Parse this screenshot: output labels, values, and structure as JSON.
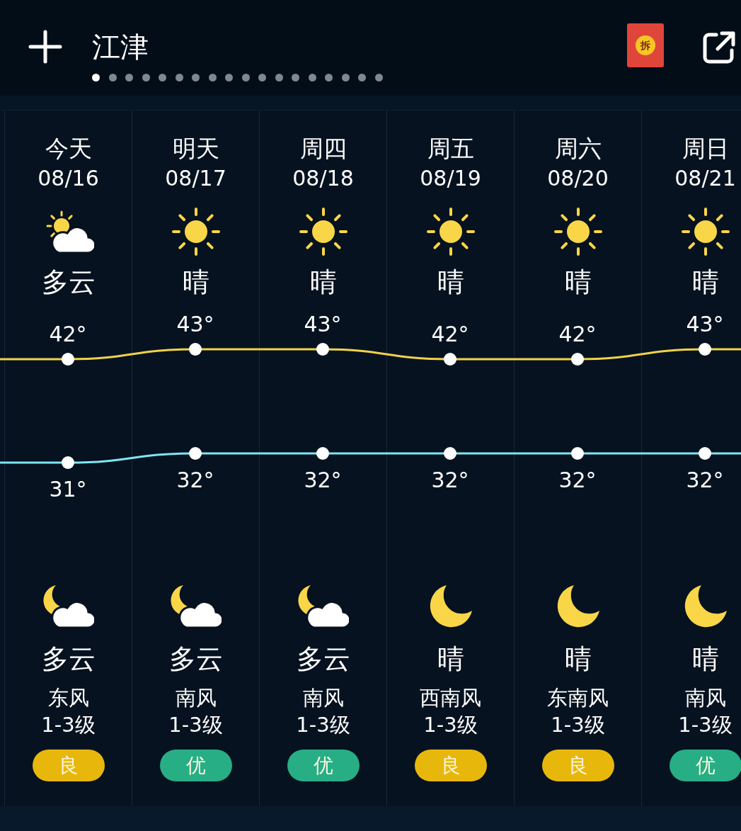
{
  "header": {
    "city": "江津",
    "red_packet": "拆"
  },
  "pages": [
    {
      "selected": true
    },
    {
      "selected": false
    },
    {
      "selected": false
    },
    {
      "selected": false
    },
    {
      "selected": false
    },
    {
      "selected": false
    },
    {
      "selected": false
    },
    {
      "selected": false
    },
    {
      "selected": false
    },
    {
      "selected": false
    },
    {
      "selected": false
    },
    {
      "selected": false
    },
    {
      "selected": false
    },
    {
      "selected": false
    },
    {
      "selected": false
    },
    {
      "selected": false
    },
    {
      "selected": false
    },
    {
      "selected": false
    }
  ],
  "days": [
    {
      "name": "今天",
      "date": "08/16",
      "day": {
        "kind": "partly_cloudy",
        "text": "多云"
      },
      "high": "42°",
      "low": "31°",
      "night": {
        "kind": "cloudy_night",
        "text": "多云"
      },
      "wind": "东风",
      "wind_level": "1-3级",
      "aqi": {
        "text": "良",
        "color": "#e8b70c"
      }
    },
    {
      "name": "明天",
      "date": "08/17",
      "day": {
        "kind": "sunny",
        "text": "晴"
      },
      "high": "43°",
      "low": "32°",
      "night": {
        "kind": "cloudy_night",
        "text": "多云"
      },
      "wind": "南风",
      "wind_level": "1-3级",
      "aqi": {
        "text": "优",
        "color": "#27ae85"
      }
    },
    {
      "name": "周四",
      "date": "08/18",
      "day": {
        "kind": "sunny",
        "text": "晴"
      },
      "high": "43°",
      "low": "32°",
      "night": {
        "kind": "cloudy_night",
        "text": "多云"
      },
      "wind": "南风",
      "wind_level": "1-3级",
      "aqi": {
        "text": "优",
        "color": "#27ae85"
      }
    },
    {
      "name": "周五",
      "date": "08/19",
      "day": {
        "kind": "sunny",
        "text": "晴"
      },
      "high": "42°",
      "low": "32°",
      "night": {
        "kind": "clear_night",
        "text": "晴"
      },
      "wind": "西南风",
      "wind_level": "1-3级",
      "aqi": {
        "text": "良",
        "color": "#e8b70c"
      }
    },
    {
      "name": "周六",
      "date": "08/20",
      "day": {
        "kind": "sunny",
        "text": "晴"
      },
      "high": "42°",
      "low": "32°",
      "night": {
        "kind": "clear_night",
        "text": "晴"
      },
      "wind": "东南风",
      "wind_level": "1-3级",
      "aqi": {
        "text": "良",
        "color": "#e8b70c"
      }
    },
    {
      "name": "周日",
      "date": "08/21",
      "day": {
        "kind": "sunny",
        "text": "晴"
      },
      "high": "43°",
      "low": "32°",
      "night": {
        "kind": "clear_night",
        "text": "晴"
      },
      "wind": "南风",
      "wind_level": "1-3级",
      "aqi": {
        "text": "优",
        "color": "#27ae85"
      }
    }
  ]
}
